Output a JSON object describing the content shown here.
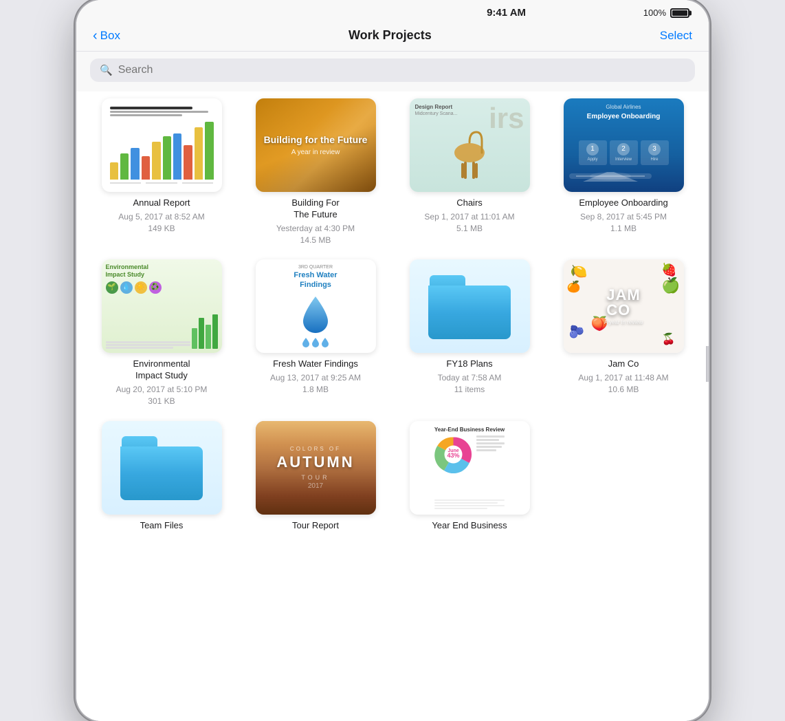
{
  "statusBar": {
    "time": "9:41 AM",
    "battery": "100%"
  },
  "navBar": {
    "backLabel": "Box",
    "title": "Work Projects",
    "selectLabel": "Select"
  },
  "search": {
    "placeholder": "Search"
  },
  "files": [
    {
      "id": "annual-report",
      "name": "Annual Report",
      "date": "Aug 5, 2017 at 8:52 AM",
      "size": "149 KB",
      "type": "document"
    },
    {
      "id": "building-for-the-future",
      "name": "Building For The Future",
      "date": "Yesterday at 4:30 PM",
      "size": "14.5 MB",
      "type": "document"
    },
    {
      "id": "chairs",
      "name": "Chairs",
      "date": "Sep 1, 2017 at 11:01 AM",
      "size": "5.1 MB",
      "type": "document"
    },
    {
      "id": "employee-onboarding",
      "name": "Employee Onboarding",
      "date": "Sep 8, 2017 at 5:45 PM",
      "size": "1.1 MB",
      "type": "document"
    },
    {
      "id": "environmental-impact-study",
      "name": "Environmental Impact Study",
      "date": "Aug 20, 2017 at 5:10 PM",
      "size": "301 KB",
      "type": "document"
    },
    {
      "id": "fresh-water-findings",
      "name": "Fresh Water Findings",
      "date": "Aug 13, 2017 at 9:25 AM",
      "size": "1.8 MB",
      "type": "document"
    },
    {
      "id": "fy18-plans",
      "name": "FY18 Plans",
      "date": "Today at 7:58 AM",
      "size": "11 items",
      "type": "folder"
    },
    {
      "id": "jam-co",
      "name": "Jam Co",
      "date": "Aug 1, 2017 at 11:48 AM",
      "size": "10.6 MB",
      "type": "document"
    },
    {
      "id": "team-files",
      "name": "Team Files",
      "date": "",
      "size": "",
      "type": "folder"
    },
    {
      "id": "tour-report",
      "name": "Tour Report",
      "date": "",
      "size": "",
      "type": "document"
    },
    {
      "id": "year-end-business",
      "name": "Year End Business",
      "date": "",
      "size": "",
      "type": "document"
    }
  ]
}
